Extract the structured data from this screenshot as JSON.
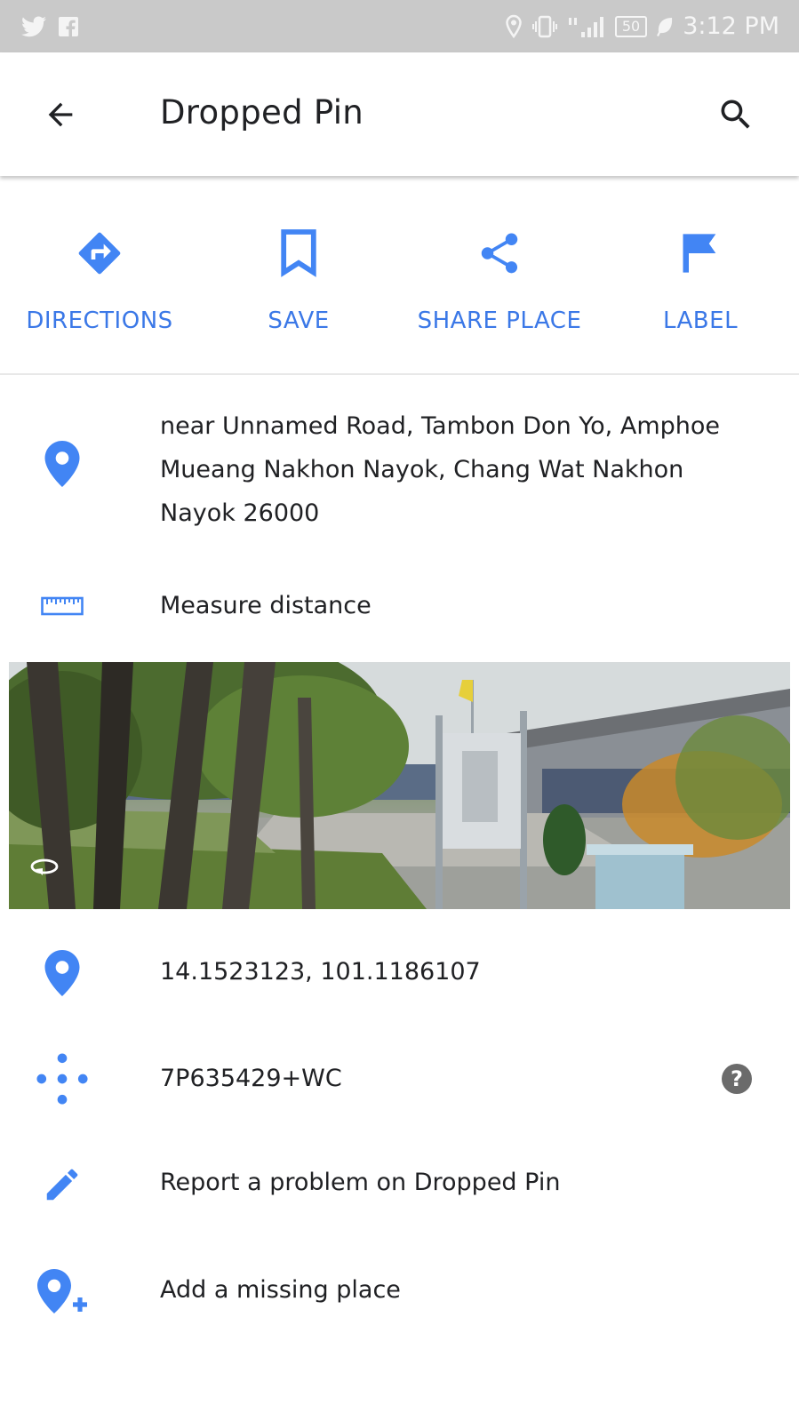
{
  "status_bar": {
    "time": "3:12 PM",
    "battery": "50",
    "left_icons": [
      "twitter-icon",
      "facebook-icon"
    ],
    "right_icons": [
      "location-icon",
      "vibrate-icon",
      "signal-icon",
      "battery-icon",
      "leaf-icon"
    ]
  },
  "app_bar": {
    "title": "Dropped Pin",
    "back_icon": "arrow-back-icon",
    "search_icon": "search-icon"
  },
  "actions": [
    {
      "label": "DIRECTIONS",
      "icon": "directions-icon"
    },
    {
      "label": "SAVE",
      "icon": "bookmark-icon"
    },
    {
      "label": "SHARE PLACE",
      "icon": "share-icon"
    },
    {
      "label": "LABEL",
      "icon": "flag-icon"
    }
  ],
  "details": {
    "address": "near Unnamed Road, Tambon Don Yo, Amphoe Mueang Nakhon Nayok, Chang Wat Nakhon Nayok 26000",
    "measure": "Measure distance",
    "coordinates": "14.1523123, 101.1186107",
    "plus_code": "7P635429+WC",
    "help": "?",
    "report": "Report a problem on Dropped Pin",
    "add_place": "Add a missing place"
  },
  "colors": {
    "accent": "#4285f4",
    "action_text": "#3b78e7",
    "status_bar": "#c9c9c9"
  }
}
